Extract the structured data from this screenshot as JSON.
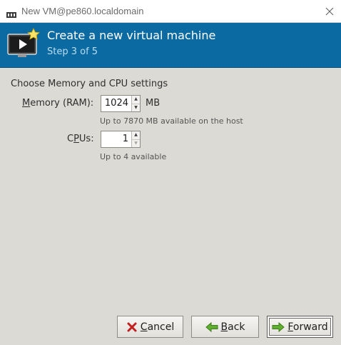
{
  "window": {
    "title": "New VM@pe860.localdomain",
    "app_icon": "virt-manager-icon",
    "close_icon": "close-icon"
  },
  "header": {
    "icon": "new-vm-wizard-icon",
    "title": "Create a new virtual machine",
    "step": "Step 3 of 5",
    "background_color": "#0b6aa2"
  },
  "form": {
    "heading": "Choose Memory and CPU settings",
    "memory": {
      "label_mnemonic": "M",
      "label_rest": "emory (RAM):",
      "value": "1024",
      "unit": "MB",
      "hint": "Up to 7870 MB available on the host"
    },
    "cpus": {
      "label_pre": "C",
      "label_mnemonic": "P",
      "label_rest": "Us:",
      "value": "1",
      "hint": "Up to 4 available"
    }
  },
  "buttons": {
    "cancel": {
      "mnemonic": "C",
      "rest": "ancel",
      "icon": "red-x-icon"
    },
    "back": {
      "mnemonic": "B",
      "rest": "ack",
      "icon": "green-left-arrow-icon"
    },
    "forward": {
      "mnemonic": "F",
      "rest": "orward",
      "icon": "green-right-arrow-icon"
    }
  }
}
